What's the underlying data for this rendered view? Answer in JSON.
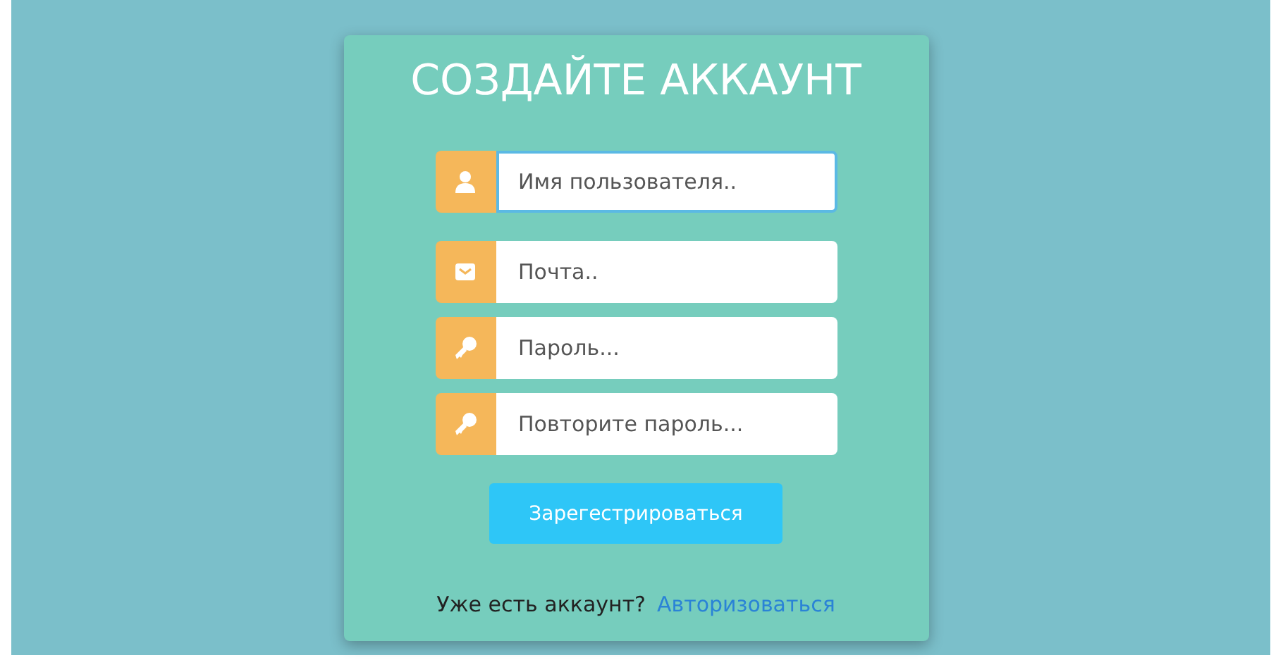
{
  "title": "СОЗДАЙТЕ АККАУНТ",
  "fields": [
    {
      "kind": "username",
      "placeholder": "Имя пользователя..",
      "focused": true
    },
    {
      "kind": "email",
      "placeholder": "Почта..",
      "focused": false
    },
    {
      "kind": "password",
      "placeholder": "Пароль...",
      "focused": false
    },
    {
      "kind": "password",
      "placeholder": "Повторите пароль...",
      "focused": false
    }
  ],
  "submit": "Зарегестрироваться",
  "footer": {
    "text": "Уже есть аккаунт?",
    "link": "Авторизоваться"
  }
}
